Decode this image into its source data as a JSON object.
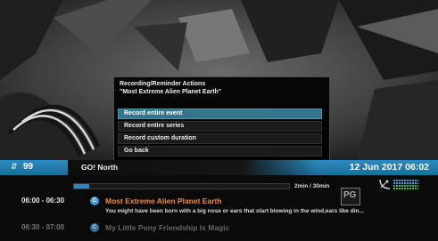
{
  "dialog": {
    "title_line1": "Recording/Reminder Actions",
    "title_line2": "\"Most Extreme Alien Planet Earth\"",
    "items": [
      {
        "label": "Record entire event",
        "selected": true
      },
      {
        "label": "Record entire series",
        "selected": false
      },
      {
        "label": "Record custom duration",
        "selected": false
      },
      {
        "label": "Go back",
        "selected": false
      }
    ]
  },
  "infobar": {
    "channel_number": "99",
    "channel_name": "GO! North",
    "datetime": "12 Jun 2017 06:02"
  },
  "now": {
    "progress_fraction": 0.07,
    "duration": "2min / 30min",
    "time": "06:00 - 06:30",
    "title": "Most Extreme Alien Planet Earth",
    "description": "You might have been born with a big nose or ears that start blowing in the wind,ears like din..."
  },
  "next": {
    "time": "06:30 - 07:00",
    "title": "My Little Pony Friendship Is Magic"
  },
  "rating": "PG",
  "colors": {
    "accent_blue": "#2c8cbf",
    "selected_item": "#35758c",
    "now_title": "#f08b3a"
  },
  "icons": {
    "channel_arrows": "up-down-arrows-icon",
    "category_badge": "c-circle-icon",
    "satellite": "satellite-dish-icon",
    "signal": "signal-strength-icon"
  }
}
